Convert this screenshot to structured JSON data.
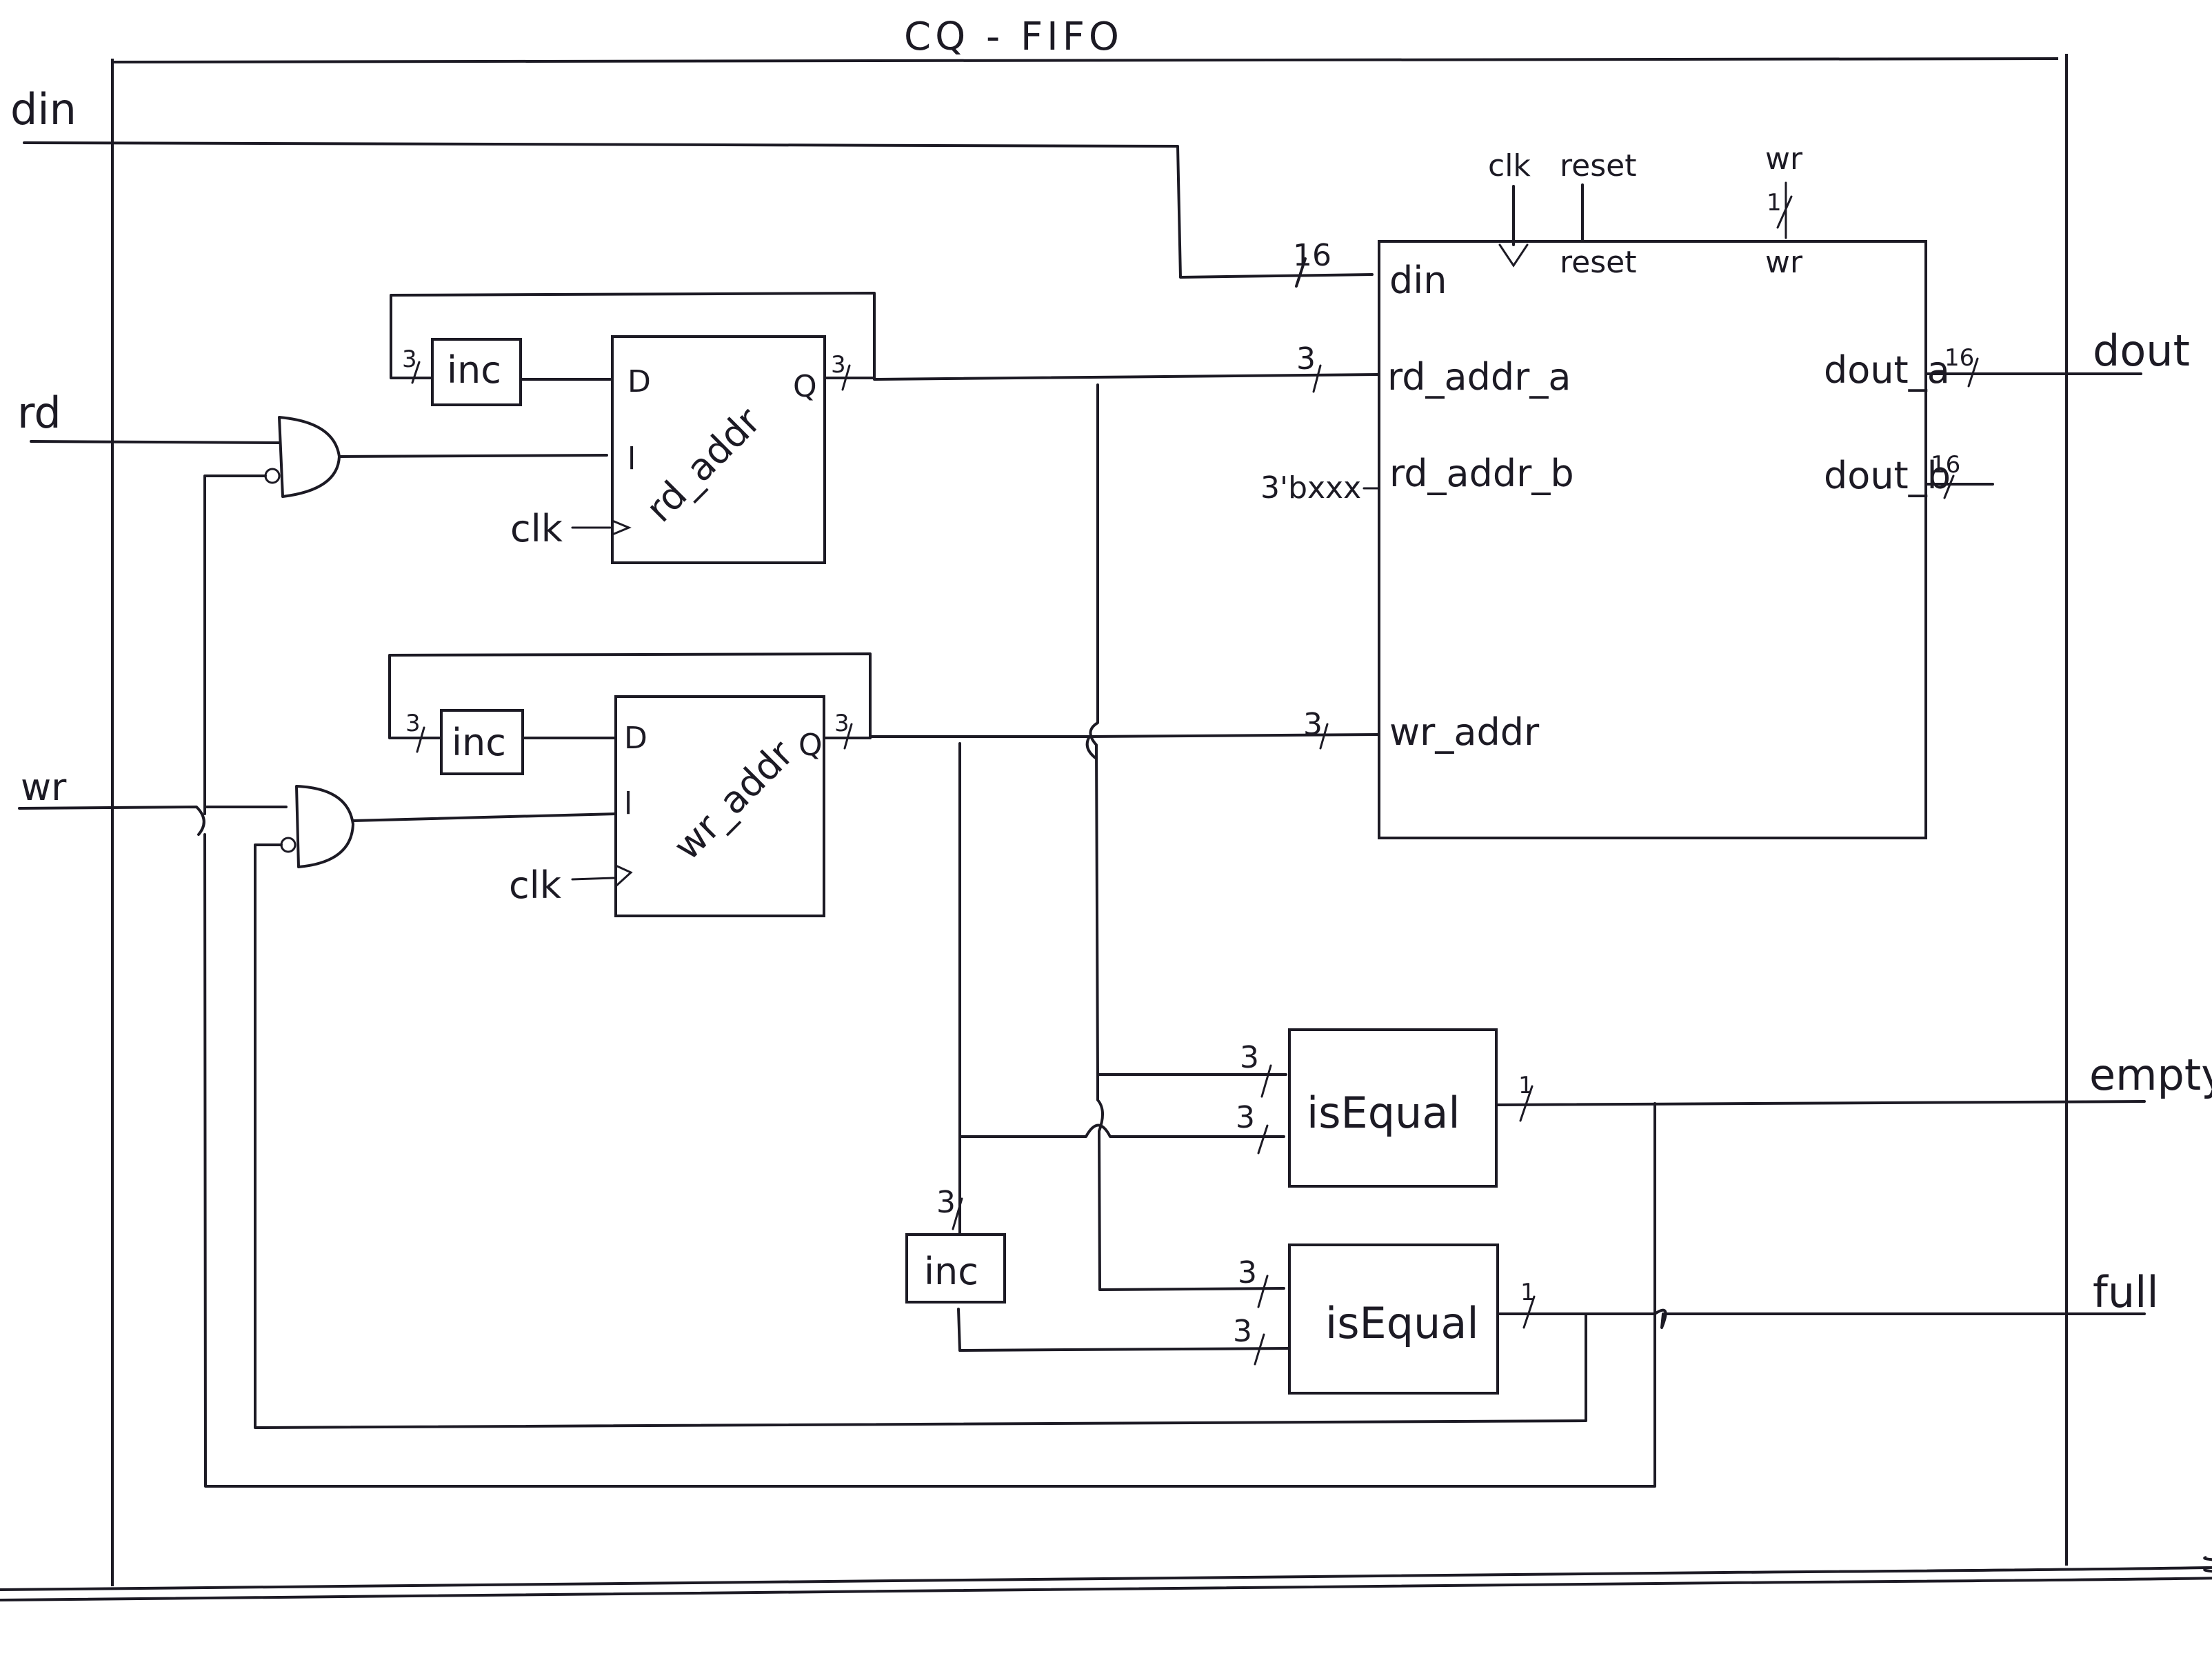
{
  "title": "CQ - FIFO",
  "inputs": {
    "din": "din",
    "rd": "rd",
    "wr": "wr"
  },
  "outputs": {
    "dout": "dout",
    "empty": "empty",
    "full": "full"
  },
  "register_file": {
    "ports_top": {
      "clk": "clk",
      "reset_ext": "reset",
      "reset_port": "reset",
      "wr_ext": "wr",
      "wr_port": "wr",
      "wr_width": "1"
    },
    "ports_left": {
      "din": "din",
      "din_width": "16",
      "rd_addr_a": "rd_addr_a",
      "rd_addr_a_width": "3",
      "rd_addr_b": "rd_addr_b",
      "rd_addr_b_const": "3'bxxx",
      "wr_addr": "wr_addr",
      "wr_addr_width": "3"
    },
    "ports_right": {
      "dout_a": "dout_a",
      "dout_a_width": "16",
      "dout_b": "dout_b",
      "dout_b_width": "16"
    }
  },
  "rd_register": {
    "name": "rd_addr",
    "d": "D",
    "q": "Q",
    "load": "l",
    "clk": "clk",
    "inc": "inc",
    "in_width": "3",
    "out_width": "3"
  },
  "wr_register": {
    "name": "wr_addr",
    "d": "D",
    "q": "Q",
    "load": "l",
    "clk": "clk",
    "inc": "inc",
    "in_width": "3",
    "out_width": "3"
  },
  "comparators": [
    {
      "name": "isEqual",
      "in1_width": "3",
      "in2_width": "3",
      "out_width": "1"
    },
    {
      "name": "isEqual",
      "in1_width": "3",
      "in2_width": "3",
      "out_width": "1"
    }
  ],
  "lower_inc": {
    "name": "inc",
    "width": "3"
  }
}
